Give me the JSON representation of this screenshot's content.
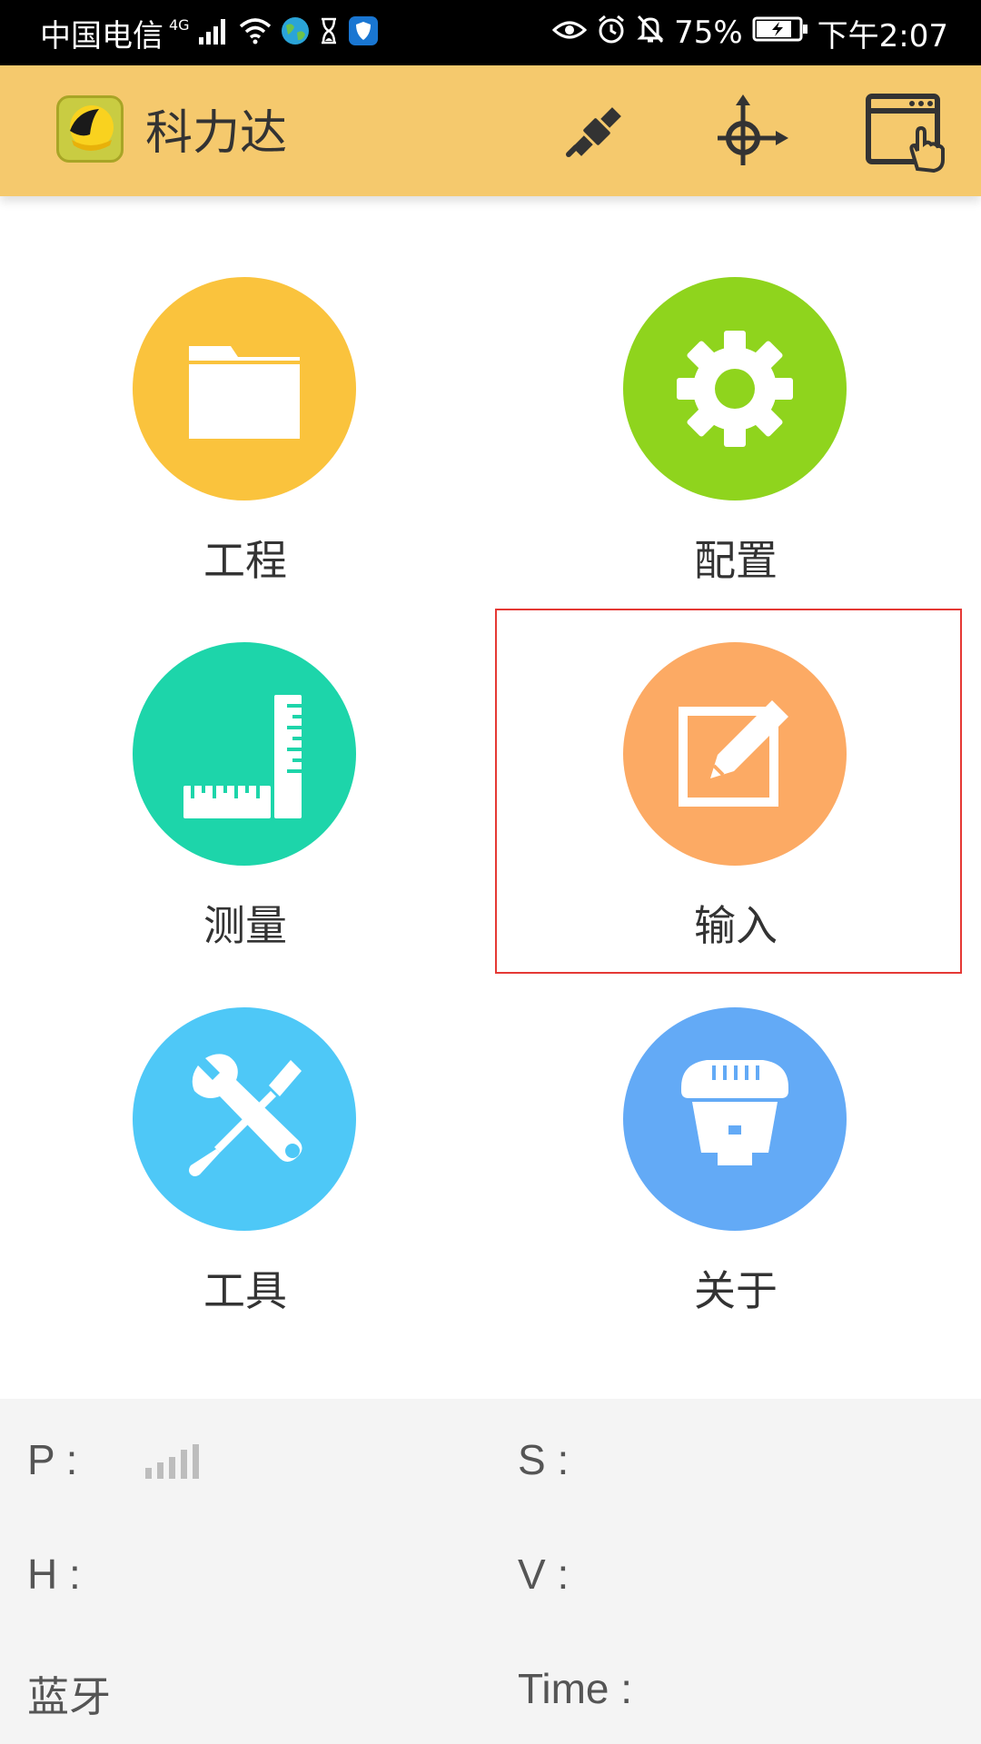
{
  "status_bar": {
    "carrier": "中国电信",
    "network": "4G",
    "battery": "75%",
    "time": "下午2:07",
    "icons": [
      "signal-icon",
      "wifi-icon",
      "globe-icon",
      "hourglass-icon",
      "shield-icon",
      "eye-icon",
      "alarm-icon",
      "bell-off-icon",
      "battery-icon"
    ]
  },
  "app_bar": {
    "title": "科力达",
    "actions": [
      "satellite-icon",
      "crosshair-icon",
      "window-hand-icon"
    ],
    "background": "#f5c96d"
  },
  "menu": {
    "items": [
      {
        "label": "工程",
        "icon": "folder-icon",
        "color": "#fac33d"
      },
      {
        "label": "配置",
        "icon": "gear-icon",
        "color": "#8fd41d"
      },
      {
        "label": "测量",
        "icon": "ruler-icon",
        "color": "#1dd5aa"
      },
      {
        "label": "输入",
        "icon": "edit-icon",
        "color": "#fcaa64"
      },
      {
        "label": "工具",
        "icon": "tools-icon",
        "color": "#4ec8f7"
      },
      {
        "label": "关于",
        "icon": "receiver-icon",
        "color": "#63aaf6"
      }
    ],
    "highlighted_item": "输入",
    "highlight_color": "#e53935"
  },
  "footer": {
    "p_label": "P :",
    "s_label": "S :",
    "h_label": "H :",
    "v_label": "V :",
    "bluetooth_label": "蓝牙",
    "time_label": "Time :"
  }
}
